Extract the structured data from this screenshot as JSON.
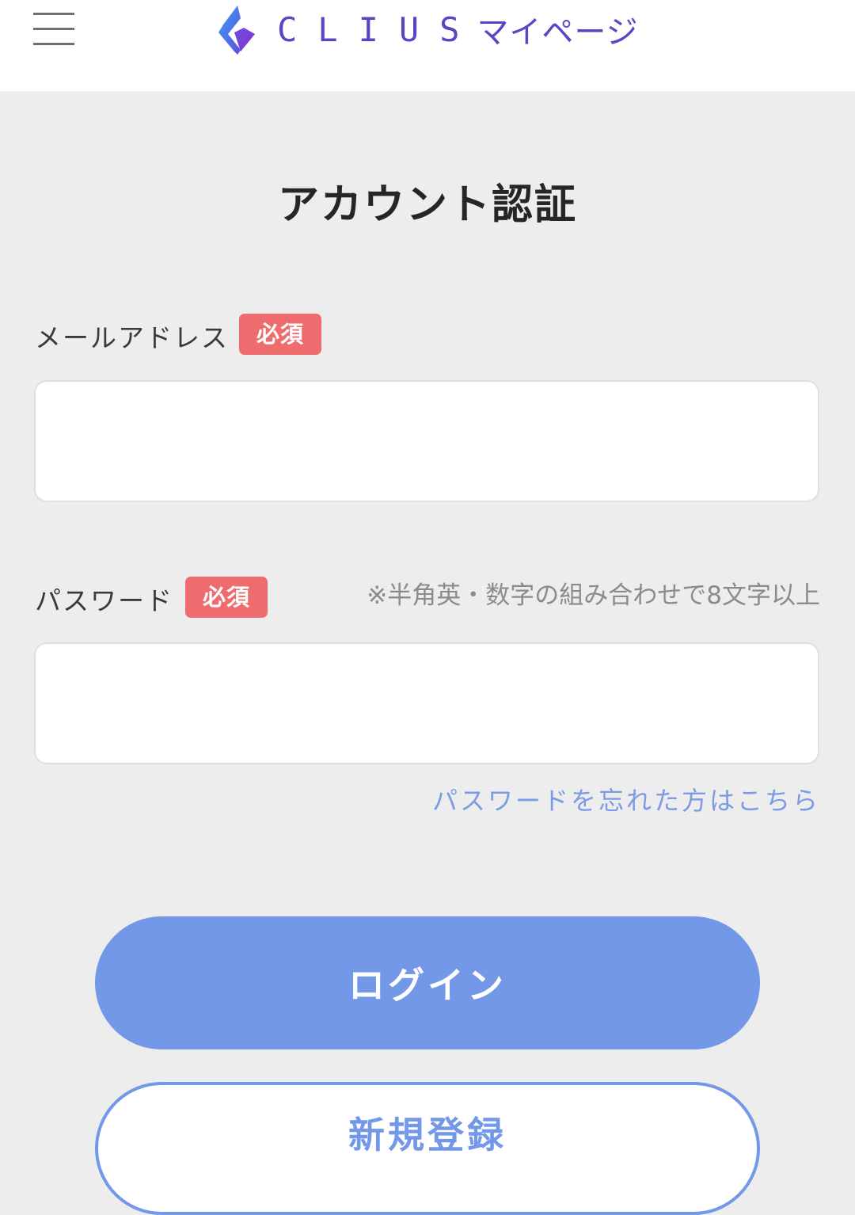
{
  "header": {
    "menu_icon": "hamburger-menu-icon",
    "logo_icon": "clius-logo-icon",
    "brand_name": "CLIUS",
    "brand_suffix": "マイページ",
    "brand_colors": [
      "#4a7df0",
      "#7a3fd6"
    ]
  },
  "main": {
    "title": "アカウント認証",
    "email": {
      "label": "メールアドレス",
      "required_badge": "必須",
      "value": "",
      "placeholder": ""
    },
    "password": {
      "label": "パスワード",
      "required_badge": "必須",
      "hint": "※半角英・数字の組み合わせで8文字以上",
      "value": "",
      "placeholder": ""
    },
    "forgot_password_link": "パスワードを忘れた方はこちら",
    "login_button": "ログイン",
    "register_button": "新規登録"
  },
  "colors": {
    "background": "#ededed",
    "badge": "#ee6b6e",
    "accent": "#7398e8",
    "link": "#7b9be3"
  }
}
